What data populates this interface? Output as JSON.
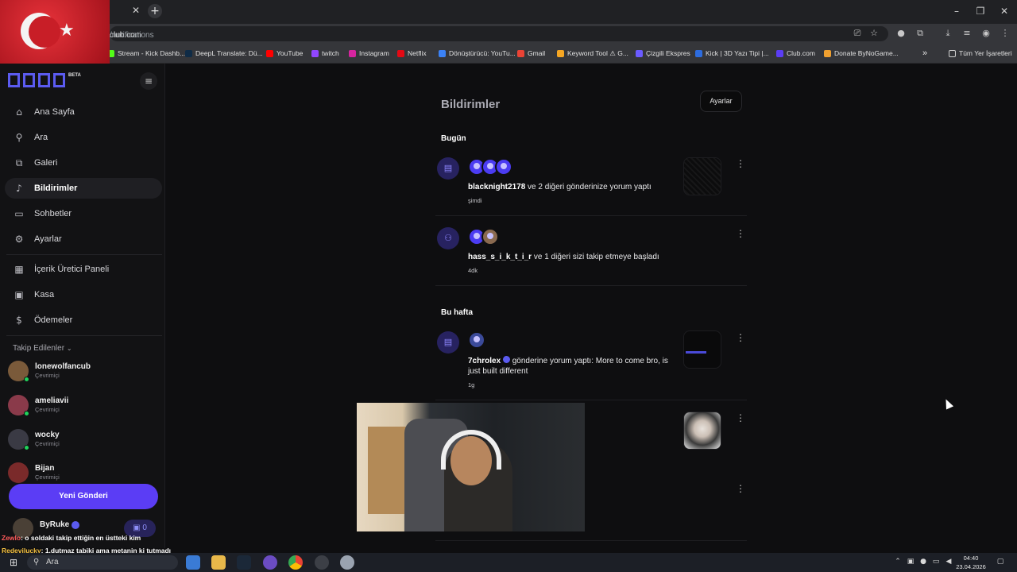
{
  "browser": {
    "url_host": "club.com",
    "url_path": "/notifications",
    "bookmarks": [
      "Stream - Kick Dashb...",
      "DeepL Translate: Dü...",
      "YouTube",
      "twitch",
      "Instagram",
      "Netflix",
      "Dönüştürücü: YouTu...",
      "Gmail",
      "Keyword Tool ⚠ G...",
      "Çizgili Ekspres",
      "Kick | 3D Yazı Tipi |...",
      "Club.com",
      "Donate ByNoGame..."
    ],
    "more_bookmarks": "»",
    "all_bookmarks": "Tüm Yer İşaretleri"
  },
  "sidebar": {
    "logo_badge": "BETA",
    "nav": [
      {
        "label": "Ana Sayfa",
        "icon": "home-icon"
      },
      {
        "label": "Ara",
        "icon": "search-icon"
      },
      {
        "label": "Galeri",
        "icon": "gallery-icon"
      },
      {
        "label": "Bildirimler",
        "icon": "bell-icon"
      },
      {
        "label": "Sohbetler",
        "icon": "chat-icon"
      },
      {
        "label": "Ayarlar",
        "icon": "gear-icon"
      },
      {
        "label": "İçerik Üretici Paneli",
        "icon": "dashboard-icon"
      },
      {
        "label": "Kasa",
        "icon": "vault-icon"
      },
      {
        "label": "Ödemeler",
        "icon": "payments-icon"
      }
    ],
    "following_title": "Takip Edilenler",
    "following": [
      {
        "name": "lonewolfancub",
        "status": "Çevrimiçi"
      },
      {
        "name": "ameliavii",
        "status": "Çevrimiçi"
      },
      {
        "name": "wocky",
        "status": "Çevrimiçi"
      },
      {
        "name": "Bijan",
        "status": "Çevrimiçi"
      }
    ],
    "new_post": "Yeni Gönderi",
    "user_name": "ByRuke",
    "user_badge": "0"
  },
  "main": {
    "title": "Bildirimler",
    "settings": "Ayarlar",
    "today": "Bugün",
    "this_week": "Bu hafta",
    "notifications": [
      {
        "user": "blacknight2178",
        "text": " ve 2 diğeri gönderinize yorum yaptı",
        "time": "şimdi"
      },
      {
        "user": "hass_s_i_k_t_i_r",
        "text": " ve 1 diğeri sizi takip etmeye başladı",
        "time": "4dk"
      },
      {
        "user": "7chrolex",
        "text": " gönderine yorum yaptı: More to come bro, is just built different",
        "time": "1g"
      }
    ]
  },
  "chat": [
    {
      "user": "Zewlo",
      "text": ": o soldaki takip ettiğin en üstteki kim"
    },
    {
      "user": "Redevilucky",
      "text": ": 1.dutmaz tabiki ama metanin ki tutmadı"
    }
  ],
  "taskbar": {
    "search": "Ara",
    "time": "04:40",
    "date": "23.04.2026"
  }
}
